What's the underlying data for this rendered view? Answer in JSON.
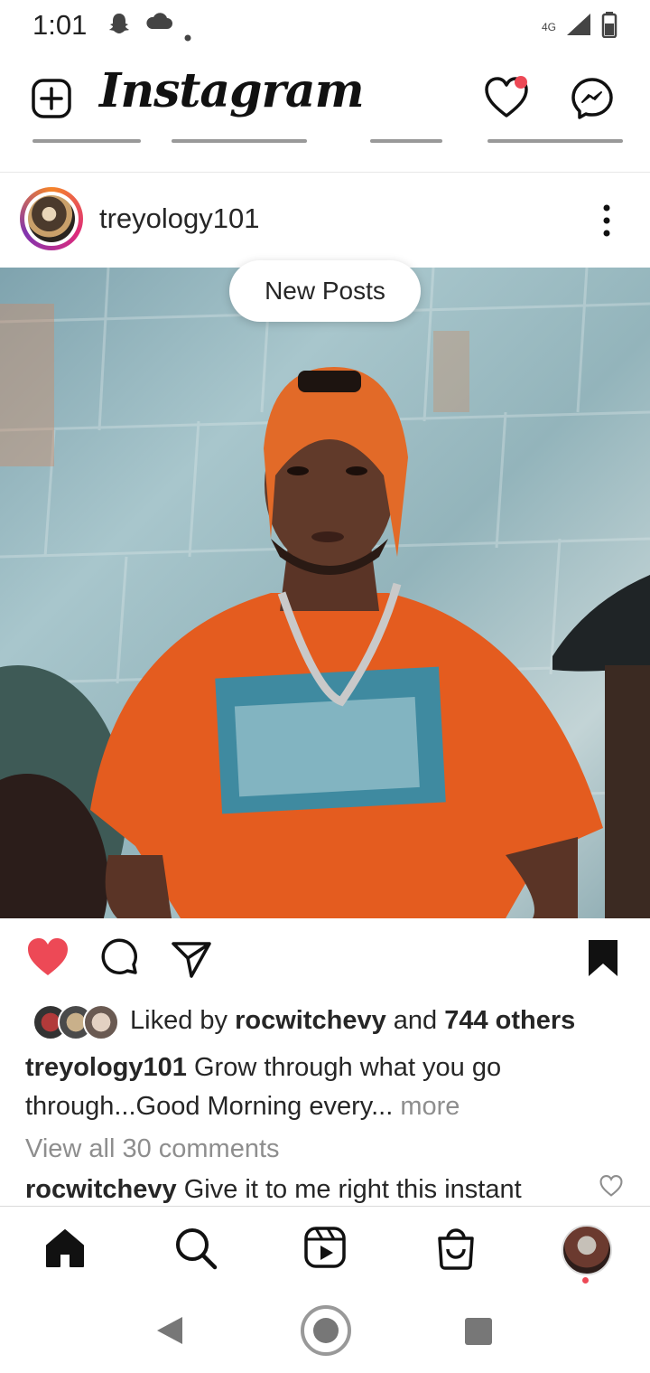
{
  "status_bar": {
    "time": "1:01",
    "network": "4G"
  },
  "header": {
    "app_title": "Instagram"
  },
  "post": {
    "username": "treyology101",
    "new_posts_label": "New Posts",
    "liked_prefix": "Liked by",
    "liked_user": "rocwitchevy",
    "liked_and": "and",
    "liked_others": "744 others",
    "caption_user": "treyology101",
    "caption_text": "Grow through what you go through...Good Morning every...",
    "caption_more": "more",
    "view_comments": "View all 30 comments",
    "comment_user": "rocwitchevy",
    "comment_text": "Give it to me right this instant",
    "liked": true,
    "saved": true
  },
  "colors": {
    "like_red": "#ed4956",
    "text": "#262626",
    "muted": "#8e8e8e"
  },
  "icons": [
    "new-post-icon",
    "activity-heart-icon",
    "messenger-icon",
    "more-options-icon",
    "like-heart-icon",
    "comment-icon",
    "share-icon",
    "bookmark-icon",
    "home-icon",
    "search-icon",
    "reels-icon",
    "shop-icon",
    "profile-avatar",
    "back-icon",
    "home-circle-icon",
    "recents-icon"
  ]
}
